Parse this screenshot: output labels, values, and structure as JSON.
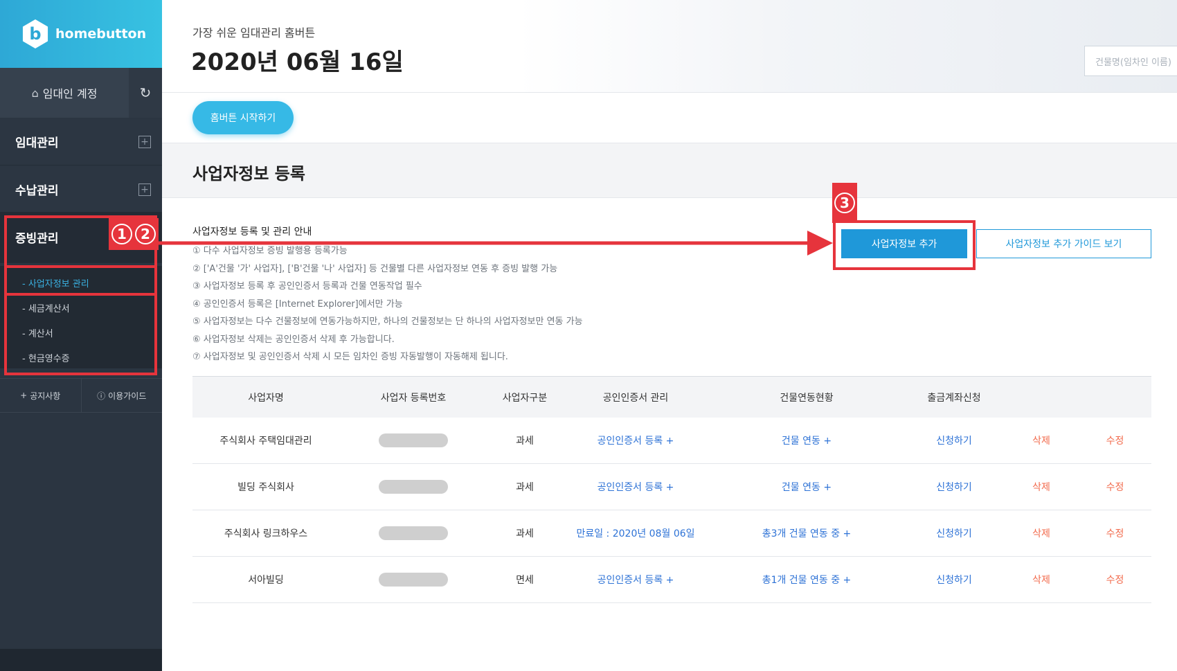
{
  "brand": {
    "logo_glyph": "b",
    "name": "homebutton",
    "accent": "#36b9e6"
  },
  "sidebar": {
    "account_label": "임대인 계정",
    "home_icon": "⌂",
    "refresh_icon": "↻",
    "menus": [
      {
        "label": "임대관리",
        "icon": "+"
      },
      {
        "label": "수납관리",
        "icon": "+"
      },
      {
        "label": "증빙관리"
      }
    ],
    "sub_items": [
      "- 사업자정보 관리",
      "- 세금계산서",
      "- 계산서",
      "- 현금영수증"
    ],
    "bottom_links": [
      {
        "icon": "+",
        "label": "공지사항"
      },
      {
        "icon": "ⓘ",
        "label": "이용가이드"
      }
    ]
  },
  "annotations": {
    "badge_12": [
      "1",
      "2"
    ],
    "badge_3": "3",
    "color": "#e6343c"
  },
  "header": {
    "tagline": "가장 쉬운 임대관리 홈버튼",
    "date": "2020년 06월 16일",
    "search_placeholder": "건물명(임차인 이름)"
  },
  "start_button": "홈버튼 시작하기",
  "section_title": "사업자정보 등록",
  "guide": {
    "title": "사업자정보 등록 및 관리 안내",
    "lines": [
      "① 다수 사업자정보 증빙 발행용 등록가능",
      "② ['A'건물 '가' 사업자], ['B'건물 '나' 사업자] 등 건물별 다른 사업자정보 연동 후 증빙 발행 가능",
      "③ 사업자정보 등록 후 공인인증서 등록과 건물 연동작업 필수",
      "④ 공인인증서 등록은 [Internet Explorer]에서만 가능",
      "⑤ 사업자정보는 다수 건물정보에 연동가능하지만, 하나의 건물정보는 단 하나의 사업자정보만 연동 가능",
      "⑥ 사업자정보 삭제는 공인인증서 삭제 후 가능합니다.",
      "⑦ 사업자정보 및 공인인증서 삭제 시 모든 임차인 증빙 자동발행이 자동해제 됩니다."
    ]
  },
  "buttons": {
    "add": "사업자정보 추가",
    "guide": "사업자정보 추가 가이드 보기"
  },
  "table": {
    "headers": [
      "사업자명",
      "사업자 등록번호",
      "사업자구분",
      "공인인증서 관리",
      "건물연동현황",
      "출금계좌신청",
      "",
      ""
    ],
    "rows": [
      {
        "name": "주식회사 주택임대관리",
        "type": "과세",
        "cert": "공인인증서 등록 +",
        "building": "건물 연동 +",
        "apply": "신청하기",
        "delete": "삭제",
        "edit": "수정"
      },
      {
        "name": "빌딩 주식회사",
        "type": "과세",
        "cert": "공인인증서 등록 +",
        "building": "건물 연동 +",
        "apply": "신청하기",
        "delete": "삭제",
        "edit": "수정"
      },
      {
        "name": "주식회사 링크하우스",
        "type": "과세",
        "cert": "만료일 : 2020년 08월 06일",
        "building": "총3개 건물 연동 중 +",
        "apply": "신청하기",
        "delete": "삭제",
        "edit": "수정"
      },
      {
        "name": "서아빌딩",
        "type": "면세",
        "cert": "공인인증서 등록 +",
        "building": "총1개 건물 연동 중 +",
        "apply": "신청하기",
        "delete": "삭제",
        "edit": "수정"
      }
    ]
  }
}
